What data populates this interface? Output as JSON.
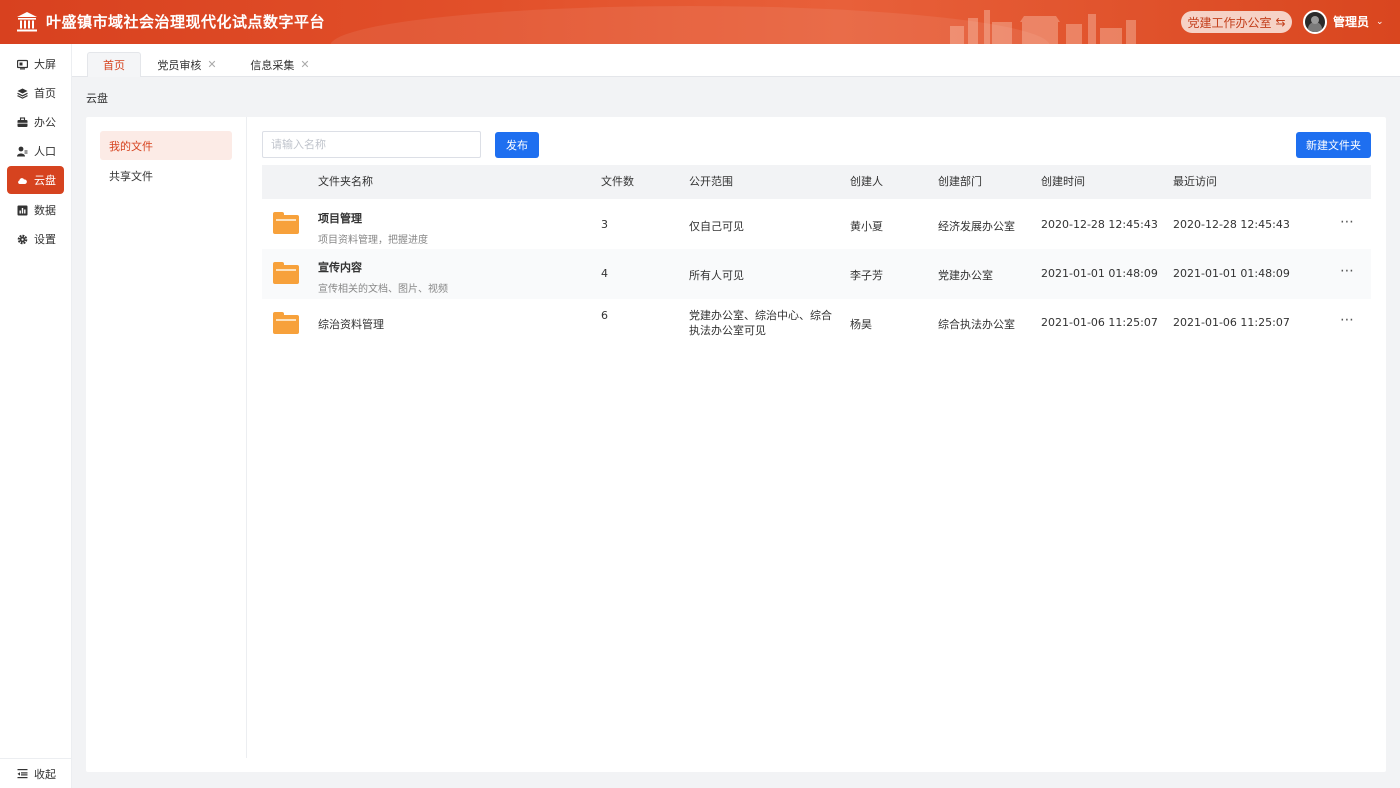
{
  "app": {
    "title": "叶盛镇市域社会治理现代化试点数字平台"
  },
  "header": {
    "office": "党建工作办公室",
    "office_swap_glyph": "⇆",
    "user": "管理员",
    "user_caret": "⌄"
  },
  "sidebar": {
    "items": [
      {
        "label": "大屏",
        "icon": "screen-icon"
      },
      {
        "label": "首页",
        "icon": "layers-icon"
      },
      {
        "label": "办公",
        "icon": "briefcase-icon"
      },
      {
        "label": "人口",
        "icon": "people-icon"
      },
      {
        "label": "云盘",
        "icon": "cloud-icon"
      },
      {
        "label": "数据",
        "icon": "chart-icon"
      },
      {
        "label": "设置",
        "icon": "gear-icon"
      }
    ],
    "active_index": 4,
    "collapse_label": "收起"
  },
  "tabs": [
    {
      "label": "首页",
      "closable": false
    },
    {
      "label": "党员审核",
      "closable": true
    },
    {
      "label": "信息采集",
      "closable": true
    }
  ],
  "tab_close_glyph": "✕",
  "breadcrumb": "云盘",
  "file_nav": {
    "my_files": "我的文件",
    "shared_files": "共享文件"
  },
  "toolbar": {
    "search_placeholder": "请输入名称",
    "publish": "发布",
    "new_folder": "新建文件夹"
  },
  "table": {
    "columns": [
      "文件夹名称",
      "文件数",
      "公开范围",
      "创建人",
      "创建部门",
      "创建时间",
      "最近访问"
    ],
    "rows": [
      {
        "name": "项目管理",
        "desc": "项目资料管理，把握进度",
        "count": "3",
        "scope": "仅自己可见",
        "creator": "黄小夏",
        "dept": "经济发展办公室",
        "created": "2020-12-28 12:45:43",
        "visited": "2020-12-28 12:45:43"
      },
      {
        "name": "宣传内容",
        "desc": "宣传相关的文档、图片、视频",
        "count": "4",
        "scope": "所有人可见",
        "creator": "李子芳",
        "dept": "党建办公室",
        "created": "2021-01-01 01:48:09",
        "visited": "2021-01-01 01:48:09"
      },
      {
        "name": "综治资料管理",
        "desc": "",
        "count": "6",
        "scope": "党建办公室、综治中心、综合执法办公室可见",
        "creator": "杨昊",
        "dept": "综合执法办公室",
        "created": "2021-01-06 11:25:07",
        "visited": "2021-01-06 11:25:07"
      }
    ],
    "more_glyph": "⋯"
  },
  "colors": {
    "brand": "#d6431f",
    "primary_button": "#1e6ff0",
    "folder": "#f7a13b"
  }
}
